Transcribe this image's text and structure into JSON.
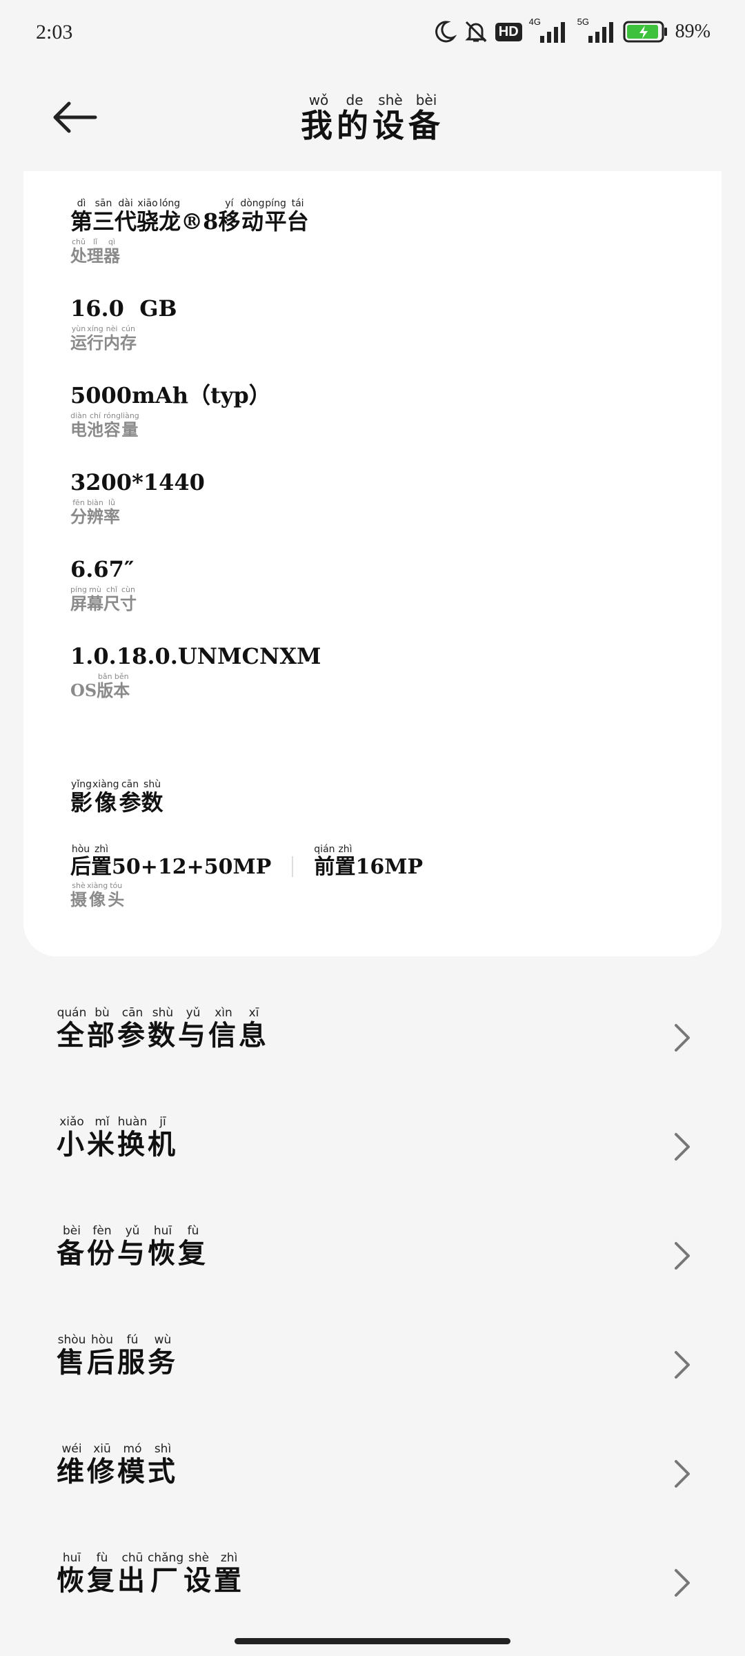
{
  "status_bar": {
    "time": "2:03",
    "network_4g": "4G",
    "network_5g": "5G",
    "hd_badge": "HD",
    "battery": "89%",
    "icons": [
      "moon-icon",
      "bell-off-icon",
      "hd-icon",
      "signal-4g-icon",
      "signal-5g-icon",
      "battery-charging-icon"
    ]
  },
  "header": {
    "title_chars": [
      {
        "c": "我",
        "p": "wǒ"
      },
      {
        "c": "的",
        "p": "de"
      },
      {
        "c": "设",
        "p": "shè"
      },
      {
        "c": "备",
        "p": "bèi"
      }
    ]
  },
  "specs": {
    "processor": {
      "value_prefix_chars": [
        {
          "c": "第",
          "p": "dì"
        },
        {
          "c": "三",
          "p": "sān"
        },
        {
          "c": "代",
          "p": "dài"
        },
        {
          "c": "骁",
          "p": "xiāo"
        },
        {
          "c": "龙",
          "p": "lóng"
        }
      ],
      "value_mid": "®8",
      "value_suffix_chars": [
        {
          "c": "移",
          "p": "yí"
        },
        {
          "c": "动",
          "p": "dòng"
        },
        {
          "c": "平",
          "p": "píng"
        },
        {
          "c": "台",
          "p": "tái"
        }
      ],
      "label_chars": [
        {
          "c": "处",
          "p": "chǔ"
        },
        {
          "c": "理",
          "p": "lǐ"
        },
        {
          "c": "器",
          "p": "qì"
        }
      ]
    },
    "ram": {
      "value": "16.0  GB",
      "label_chars": [
        {
          "c": "运",
          "p": "yùn"
        },
        {
          "c": "行",
          "p": "xíng"
        },
        {
          "c": "内",
          "p": "nèi"
        },
        {
          "c": "存",
          "p": "cún"
        }
      ]
    },
    "battery": {
      "value": "5000mAh（typ）",
      "label_chars": [
        {
          "c": "电",
          "p": "diàn"
        },
        {
          "c": "池",
          "p": "chí"
        },
        {
          "c": "容",
          "p": "róng"
        },
        {
          "c": "量",
          "p": "liàng"
        }
      ]
    },
    "resolution": {
      "value": "3200*1440",
      "label_chars": [
        {
          "c": "分",
          "p": "fēn"
        },
        {
          "c": "辨",
          "p": "biàn"
        },
        {
          "c": "率",
          "p": "lǜ"
        }
      ]
    },
    "screen_size": {
      "value": "6.67″",
      "label_chars": [
        {
          "c": "屏",
          "p": "píng"
        },
        {
          "c": "幕",
          "p": "mù"
        },
        {
          "c": "尺",
          "p": "chǐ"
        },
        {
          "c": "寸",
          "p": "cùn"
        }
      ]
    },
    "os_version": {
      "value": "1.0.18.0.UNMCNXM",
      "label_prefix": "OS",
      "label_chars": [
        {
          "c": "版",
          "p": "bǎn"
        },
        {
          "c": "本",
          "p": "běn"
        }
      ]
    }
  },
  "camera": {
    "title_chars": [
      {
        "c": "影",
        "p": "yǐng"
      },
      {
        "c": "像",
        "p": "xiàng"
      },
      {
        "c": "参",
        "p": "cān"
      },
      {
        "c": "数",
        "p": "shù"
      }
    ],
    "rear_chars": [
      {
        "c": "后",
        "p": "hòu"
      },
      {
        "c": "置",
        "p": "zhì"
      }
    ],
    "rear_value": "50+12+50MP",
    "front_chars": [
      {
        "c": "前",
        "p": "qián"
      },
      {
        "c": "置",
        "p": "zhì"
      }
    ],
    "front_value": "16MP",
    "label_chars": [
      {
        "c": "摄",
        "p": "shè"
      },
      {
        "c": "像",
        "p": "xiàng"
      },
      {
        "c": "头",
        "p": "tóu"
      }
    ]
  },
  "menu": [
    {
      "key": "all-specs",
      "chars": [
        {
          "c": "全",
          "p": "quán"
        },
        {
          "c": "部",
          "p": "bù"
        },
        {
          "c": "参",
          "p": "cān"
        },
        {
          "c": "数",
          "p": "shù"
        },
        {
          "c": "与",
          "p": "yǔ"
        },
        {
          "c": "信",
          "p": "xìn"
        },
        {
          "c": "息",
          "p": "xī"
        }
      ]
    },
    {
      "key": "xiaomi-transfer",
      "chars": [
        {
          "c": "小",
          "p": "xiǎo"
        },
        {
          "c": "米",
          "p": "mǐ"
        },
        {
          "c": "换",
          "p": "huàn"
        },
        {
          "c": "机",
          "p": "jī"
        }
      ]
    },
    {
      "key": "backup-restore",
      "chars": [
        {
          "c": "备",
          "p": "bèi"
        },
        {
          "c": "份",
          "p": "fèn"
        },
        {
          "c": "与",
          "p": "yǔ"
        },
        {
          "c": "恢",
          "p": "huī"
        },
        {
          "c": "复",
          "p": "fù"
        }
      ]
    },
    {
      "key": "after-sales",
      "chars": [
        {
          "c": "售",
          "p": "shòu"
        },
        {
          "c": "后",
          "p": "hòu"
        },
        {
          "c": "服",
          "p": "fú"
        },
        {
          "c": "务",
          "p": "wù"
        }
      ]
    },
    {
      "key": "repair-mode",
      "chars": [
        {
          "c": "维",
          "p": "wéi"
        },
        {
          "c": "修",
          "p": "xiū"
        },
        {
          "c": "模",
          "p": "mó"
        },
        {
          "c": "式",
          "p": "shì"
        }
      ]
    },
    {
      "key": "factory-reset",
      "chars": [
        {
          "c": "恢",
          "p": "huī"
        },
        {
          "c": "复",
          "p": "fù"
        },
        {
          "c": "出",
          "p": "chū"
        },
        {
          "c": "厂",
          "p": "chǎng"
        },
        {
          "c": "设",
          "p": "shè"
        },
        {
          "c": "置",
          "p": "zhì"
        }
      ]
    }
  ]
}
